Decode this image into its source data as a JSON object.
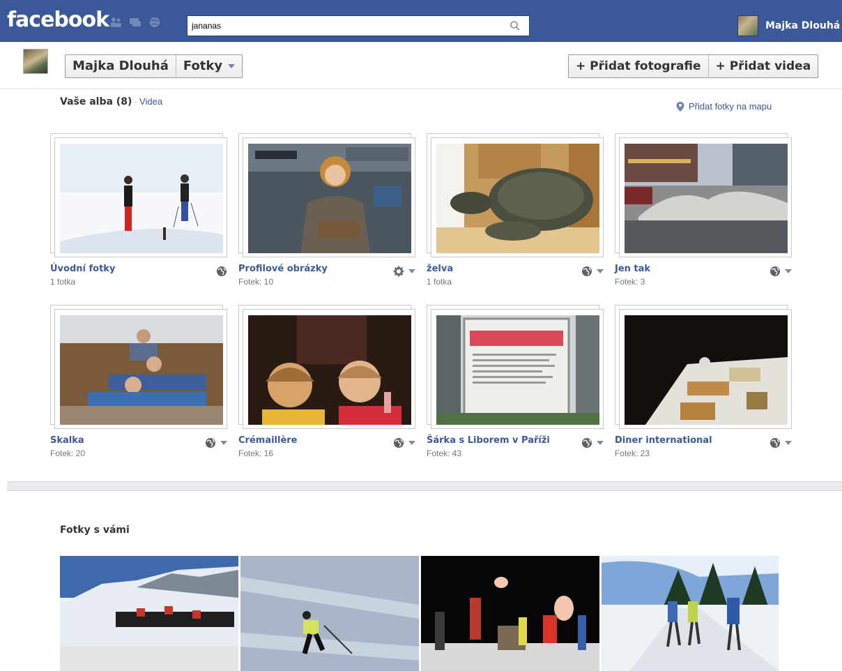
{
  "topbar": {
    "logo": "facebook",
    "search_value": "jananas",
    "user_name": "Majka Dlouhá",
    "jewels": [
      "friend-requests-icon",
      "messages-icon",
      "notifications-icon"
    ]
  },
  "header": {
    "crumbs": [
      "Majka Dlouhá",
      "Fotky"
    ],
    "add_photos": "+ Přidat fotografie",
    "add_video": "+ Přidat videa"
  },
  "albums_section": {
    "title": "Vaše alba (8)",
    "separator": "·",
    "videos_link": "Videa",
    "map_link": "Přidat fotky na mapu"
  },
  "albums": [
    {
      "title": "Úvodní fotky",
      "count": "1 fotka",
      "privacy": "globe-icon",
      "has_caret": false
    },
    {
      "title": "Profilové obrázky",
      "count": "Fotek: 10",
      "privacy": "gear-icon",
      "has_caret": true
    },
    {
      "title": "želva",
      "count": "1 fotka",
      "privacy": "globe-icon",
      "has_caret": true
    },
    {
      "title": "Jen tak",
      "count": "Fotek: 3",
      "privacy": "globe-icon",
      "has_caret": true
    },
    {
      "title": "Skalka",
      "count": "Fotek: 20",
      "privacy": "globe-icon",
      "has_caret": true
    },
    {
      "title": "Crémaillère",
      "count": "Fotek: 16",
      "privacy": "globe-icon",
      "has_caret": true
    },
    {
      "title": "Šárka s Liborem v Paříži",
      "count": "Fotek: 43",
      "privacy": "globe-icon",
      "has_caret": true
    },
    {
      "title": "Diner international",
      "count": "Fotek: 23",
      "privacy": "globe-icon",
      "has_caret": true
    }
  ],
  "tagged_section": {
    "title": "Fotky s vámi"
  },
  "colors": {
    "brand": "#3b5998",
    "link": "#3b5998",
    "muted": "#777777"
  }
}
